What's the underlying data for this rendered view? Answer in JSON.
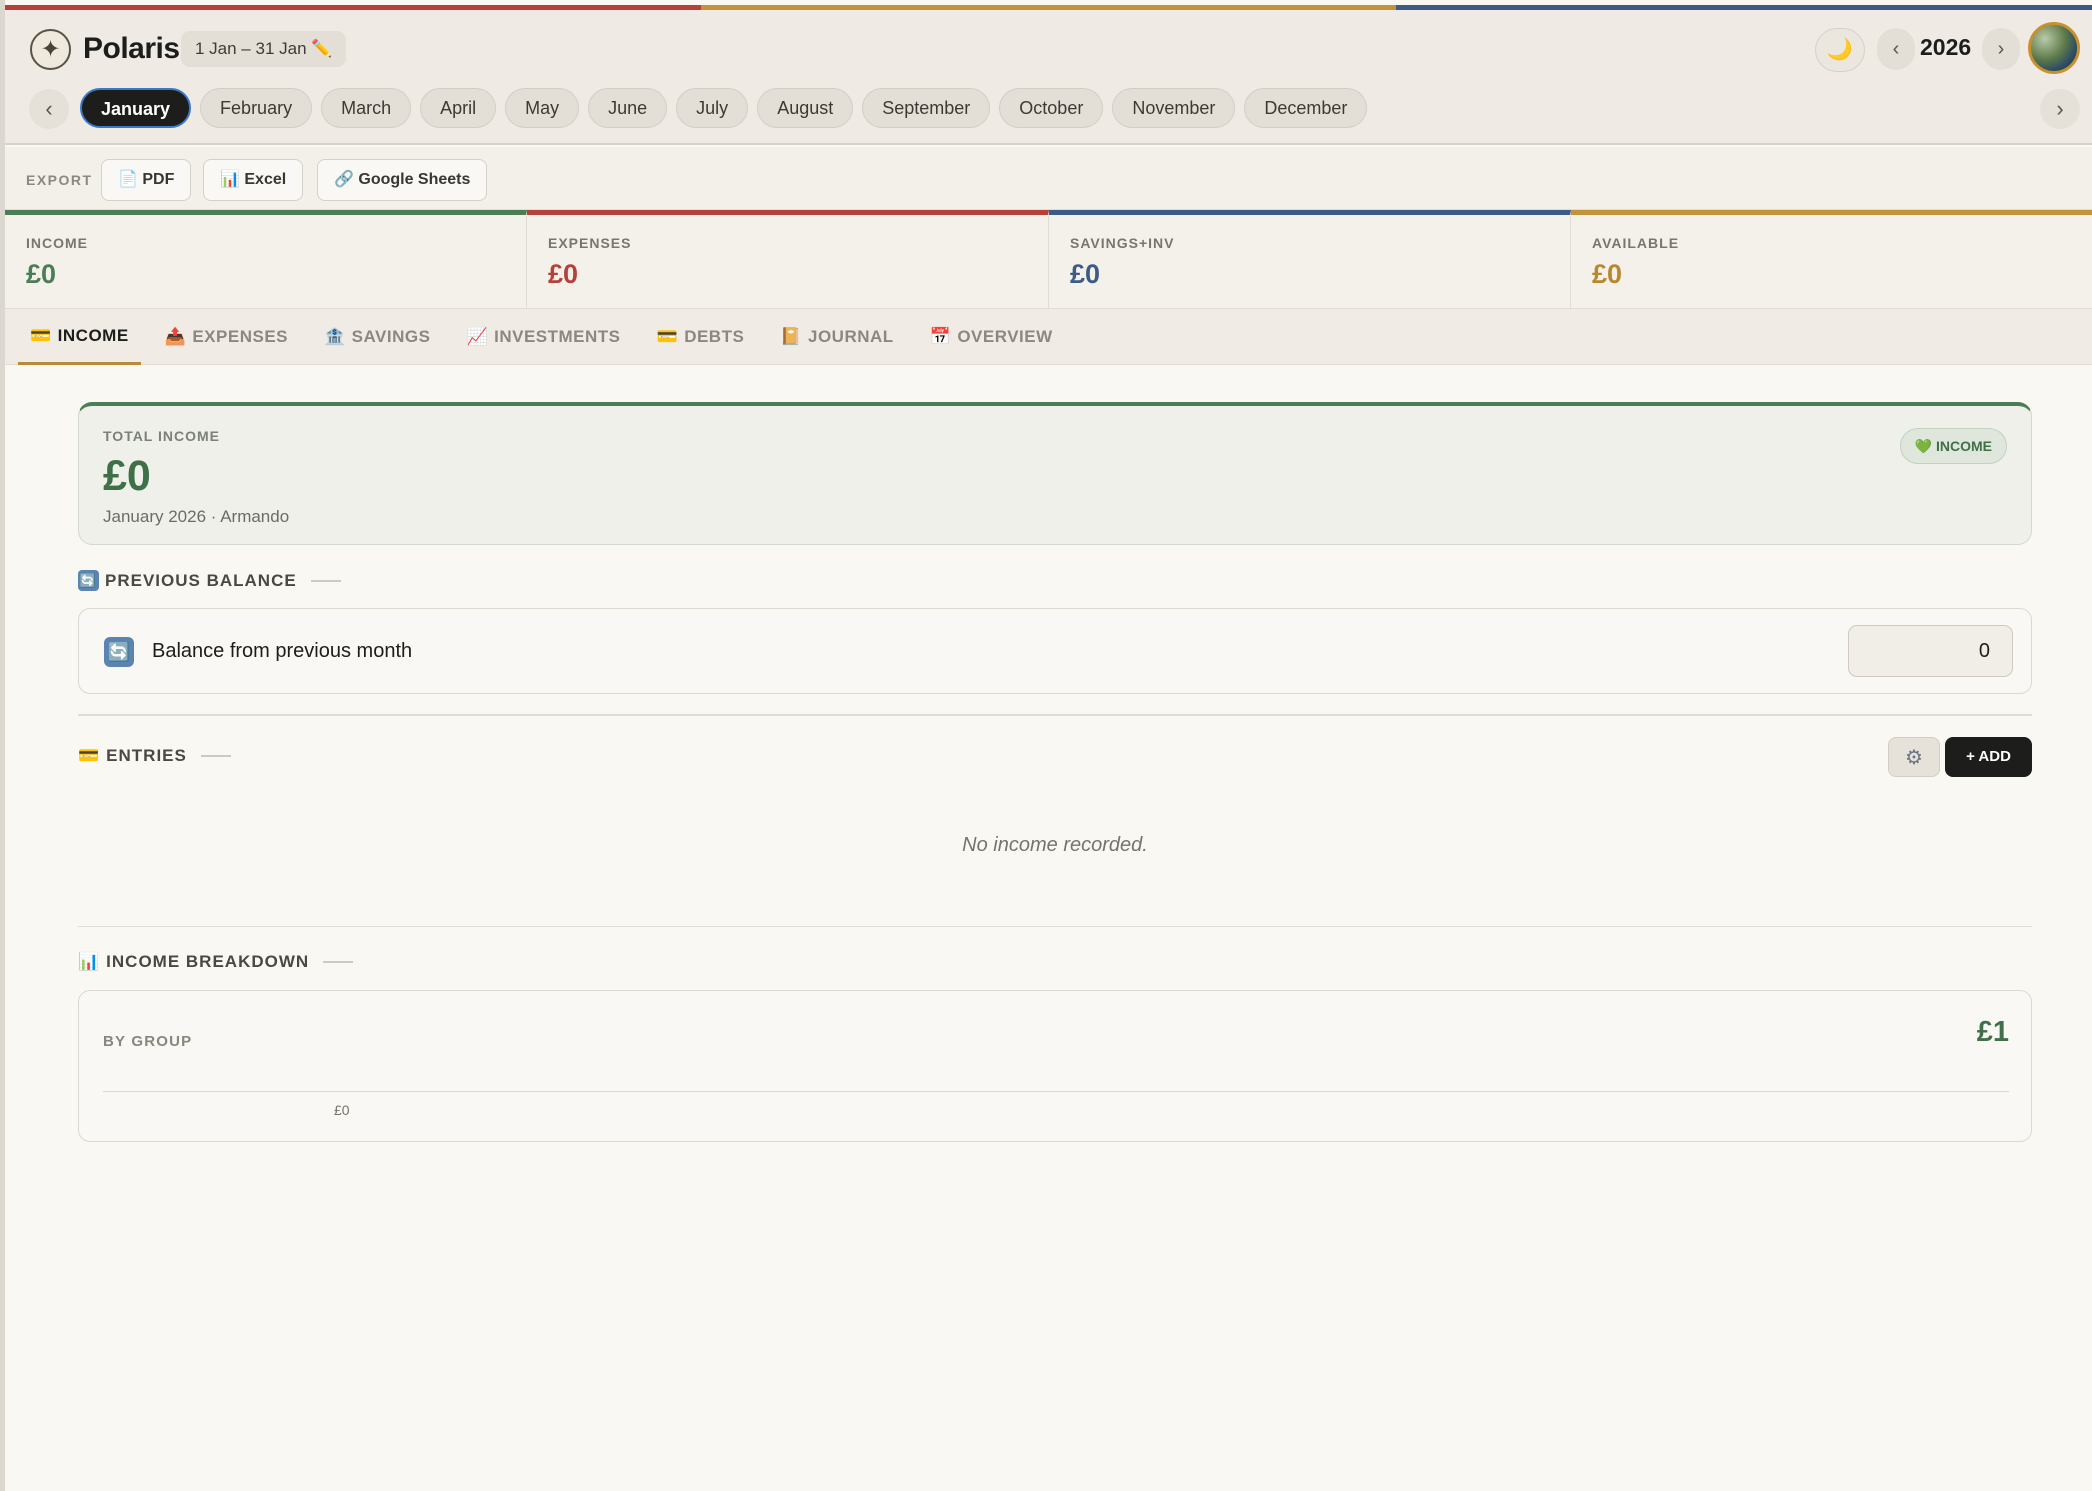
{
  "colors": {
    "income": "#4b7d57",
    "expenses": "#b6403a",
    "savings": "#3d5b87",
    "available": "#c1943a",
    "dark": "#1d1d1b"
  },
  "header": {
    "brand": "Polaris",
    "date_range": "1 Jan – 31 Jan",
    "edit_icon": "✏️",
    "year": "2026",
    "prev_year": "‹",
    "next_year": "›",
    "theme_icon": "moon-icon",
    "theme_glyph": "🌙",
    "logo_glyph": "✦"
  },
  "months": {
    "prev": "‹",
    "next": "›",
    "items": [
      "January",
      "February",
      "March",
      "April",
      "May",
      "June",
      "July",
      "August",
      "September",
      "October",
      "November",
      "December"
    ],
    "active": "January"
  },
  "export": {
    "label": "EXPORT",
    "pdf": "PDF",
    "excel": "Excel",
    "sheets": "Google Sheets",
    "pdf_icon": "📄",
    "excel_icon": "📊",
    "sheets_icon": "🔗"
  },
  "kpis": [
    {
      "label": "INCOME",
      "value": "£0"
    },
    {
      "label": "EXPENSES",
      "value": "£0"
    },
    {
      "label": "SAVINGS+INV",
      "value": "£0"
    },
    {
      "label": "AVAILABLE",
      "value": "£0"
    }
  ],
  "tabs": [
    {
      "icon": "💳",
      "label": "INCOME"
    },
    {
      "icon": "📤",
      "label": "EXPENSES"
    },
    {
      "icon": "🏦",
      "label": "SAVINGS"
    },
    {
      "icon": "📈",
      "label": "INVESTMENTS"
    },
    {
      "icon": "💳",
      "label": "DEBTS"
    },
    {
      "icon": "📔",
      "label": "JOURNAL"
    },
    {
      "icon": "📅",
      "label": "OVERVIEW"
    }
  ],
  "total": {
    "label": "TOTAL INCOME",
    "value": "£0",
    "subtitle": "January 2026 · Armando",
    "badge": "💚 INCOME"
  },
  "previous": {
    "section": "PREVIOUS BALANCE",
    "section_icon": "🔄",
    "row_label": "Balance from previous month",
    "row_icon": "🔄",
    "value": "0"
  },
  "entries": {
    "section": "ENTRIES",
    "section_icon": "💳",
    "settings_icon": "⚙",
    "add": "+ ADD",
    "empty": "No income recorded."
  },
  "breakdown": {
    "section": "INCOME BREAKDOWN",
    "section_icon": "📊",
    "by_group": "BY GROUP",
    "total": "£1",
    "axis_tick": "£0"
  }
}
